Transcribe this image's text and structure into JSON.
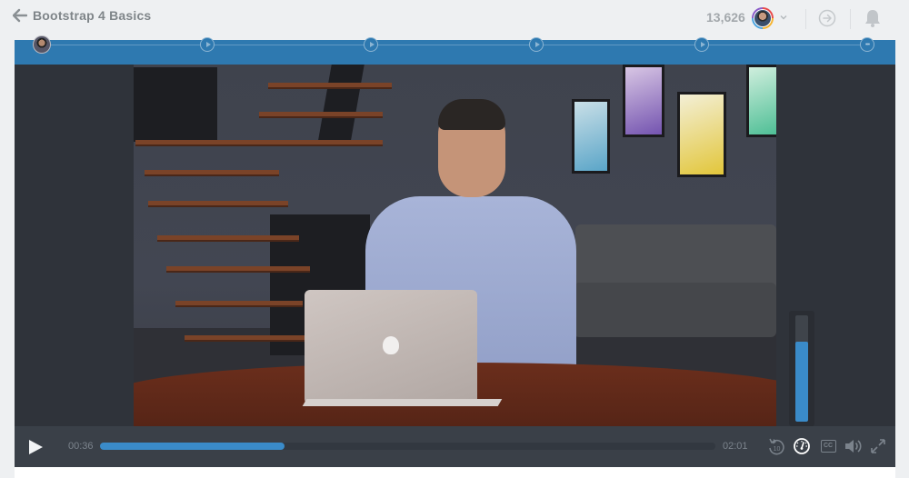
{
  "header": {
    "back_icon": "arrow-left-icon",
    "course_title": "Bootstrap 4 Basics",
    "points": "13,626",
    "avatar_icon": "user-avatar",
    "menu_icon": "chevron-down-icon",
    "next_icon": "arrow-circle-right-icon",
    "notification_icon": "bell-icon"
  },
  "chapters": {
    "markers": [
      {
        "type": "author",
        "icon": "author-avatar"
      },
      {
        "type": "video",
        "icon": "play-circle-icon"
      },
      {
        "type": "video",
        "icon": "play-circle-icon"
      },
      {
        "type": "video",
        "icon": "play-circle-icon"
      },
      {
        "type": "video",
        "icon": "play-circle-icon"
      },
      {
        "type": "more",
        "icon": "ellipsis-circle-icon",
        "label": "•••"
      }
    ]
  },
  "player": {
    "current_time": "00:36",
    "duration": "02:01",
    "progress_fraction": 0.3,
    "speed_slider_fraction": 0.75,
    "controls": {
      "play_icon": "play-icon",
      "rewind_icon": "rewind-10-icon",
      "rewind_label": "10",
      "speed_icon": "speedometer-icon",
      "captions_icon": "closed-captions-icon",
      "captions_label": "CC",
      "volume_icon": "volume-icon",
      "fullscreen_icon": "fullscreen-icon"
    },
    "colors": {
      "accent": "#3a8bc9",
      "chapter_bar": "#2e79b0",
      "controls_bg": "#3a4048",
      "player_bg": "#2f333a"
    }
  }
}
